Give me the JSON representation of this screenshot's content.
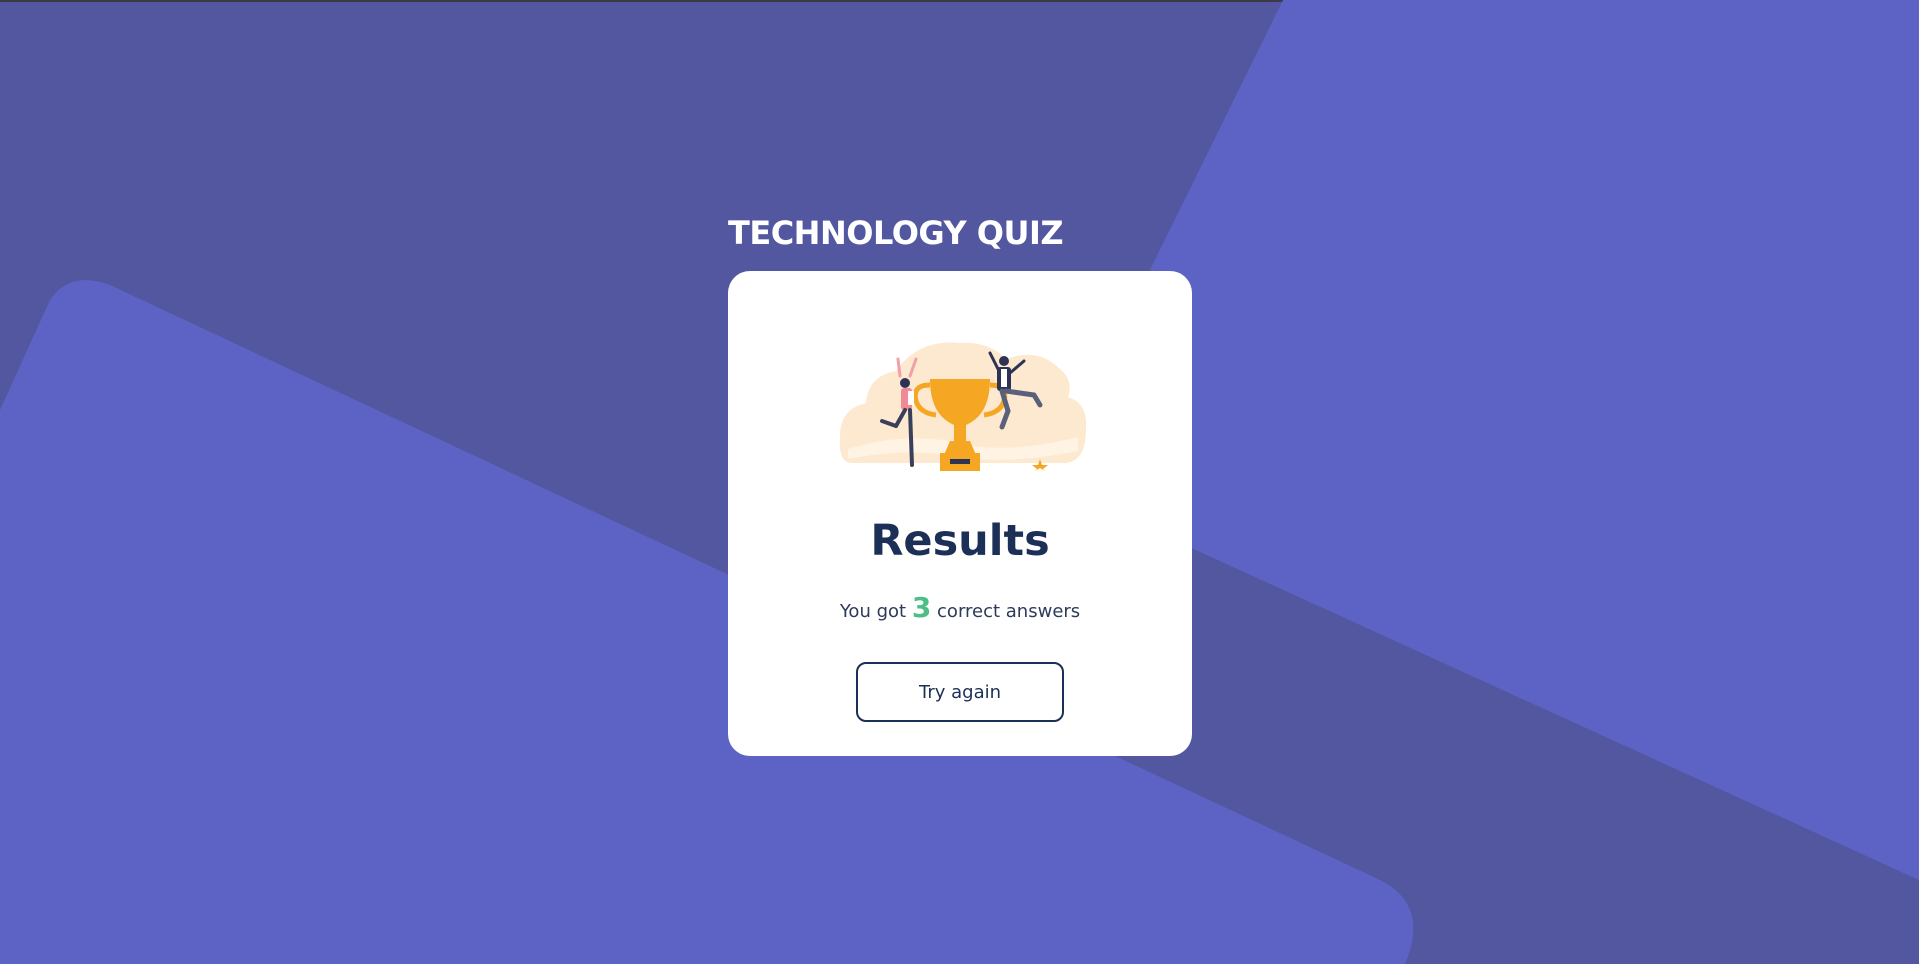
{
  "quiz": {
    "title": "TECHNOLOGY QUIZ"
  },
  "results": {
    "heading": "Results",
    "score_prefix": "You got",
    "score": "3",
    "score_suffix": "correct answers",
    "button_label": "Try again",
    "illustration": "trophy-celebration-illustration"
  },
  "colors": {
    "background": "#5257a0",
    "background_shape": "#5c63c4",
    "card": "#ffffff",
    "heading": "#1c2f56",
    "score_accent": "#4cbf86",
    "trophy": "#f5a623"
  }
}
